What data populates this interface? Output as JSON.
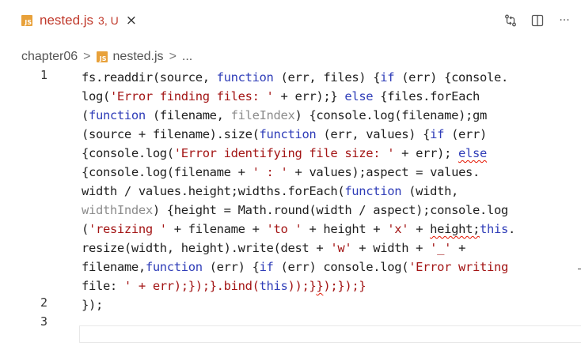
{
  "tab": {
    "badge": "JS",
    "title": "nested.js",
    "status": "3, U",
    "close": "×"
  },
  "actions": {
    "compare_icon": "compare-changes-icon",
    "split_icon": "split-editor-icon",
    "more": "···"
  },
  "breadcrumb": {
    "folder": "chapter06",
    "separator": ">",
    "badge": "JS",
    "file": "nested.js",
    "ellipsis": "..."
  },
  "gutter": {
    "line_numbers": [
      "1",
      "2",
      "3"
    ]
  },
  "code_lines": [
    "fs.readdir(source, function (err, files) {if (err) {console.",
    "log('Error finding files: ' + err);} else {files.forEach",
    "(function (filename, fileIndex) {console.log(filename);gm",
    "(source + filename).size(function (err, values) {if (err)",
    "{console.log('Error identifying file size: ' + err); else",
    "{console.log(filename + ' : ' + values);aspect = values.",
    "width / values.height;widths.forEach(function (width,",
    "widthIndex) {height = Math.round(width / aspect);console.log",
    "('resizing ' + filename + 'to ' + height + 'x' + height;this.",
    "resize(width, height).write(dest + 'w' + width + '_' +",
    "filename,function (err) {if (err) console.log('Error writing",
    "file: ' + err);});}.bind(this));}});});}",
    "});",
    ""
  ]
}
